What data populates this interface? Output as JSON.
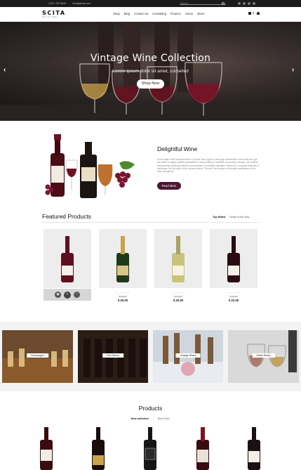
{
  "topbar": {
    "phone": "+1222 763 8849",
    "email": "info@gmail.com",
    "search_placeholder": "Search"
  },
  "header": {
    "logo": "SCITA",
    "logo_tagline": "Wine Co. Theme",
    "nav": [
      "Shop",
      "Blog",
      "Contact us",
      "Consulting",
      "Finance",
      "Home",
      "demo"
    ],
    "cart_count": "0"
  },
  "hero": {
    "title": "Vintage Wine Collection",
    "subtitle": "Lorem ipsum dolor sit amet, conseted",
    "button": "Shop Now",
    "prev": "‹",
    "next": "›"
  },
  "about": {
    "title": "Delightful Wine",
    "text": "As the base of the medical section \"Ground\" text is given a thorough examination of the body and got the advice of highly qualified specialists in various fields of medicine, according to studies, our doctors will prescribe optimal prevention and treatment of identified diseases, directed to a surgical treatment if necessary. On the basis of the medical section \"Ground\" text is given a thorough examination of the body and get the",
    "button": "Read More"
  },
  "featured": {
    "title": "Featured Products",
    "tabs": [
      "Top Rated",
      "Deals of the Day"
    ],
    "products": [
      {
        "stars": "☆☆☆☆☆",
        "old_price": "",
        "price": ""
      },
      {
        "stars": "☆☆☆☆☆",
        "old_price": "$ 28.00",
        "price": "$ 25.00"
      },
      {
        "stars": "☆☆☆☆☆",
        "old_price": "$ 24.00",
        "price": "$ 20.00"
      },
      {
        "stars": "☆☆☆☆☆",
        "old_price": "$ 24.00",
        "price": "$ 22.00"
      }
    ]
  },
  "categories": [
    "Champagne",
    "Red Wines",
    "Vintage Wines",
    "White Wines"
  ],
  "products_section": {
    "title": "Products",
    "tabs": [
      "New collection",
      "Best Seller"
    ],
    "sep": "|"
  },
  "colors": {
    "accent": "#4a1832",
    "topbar": "#1b1b1b",
    "wine": "#5e0f1e"
  }
}
